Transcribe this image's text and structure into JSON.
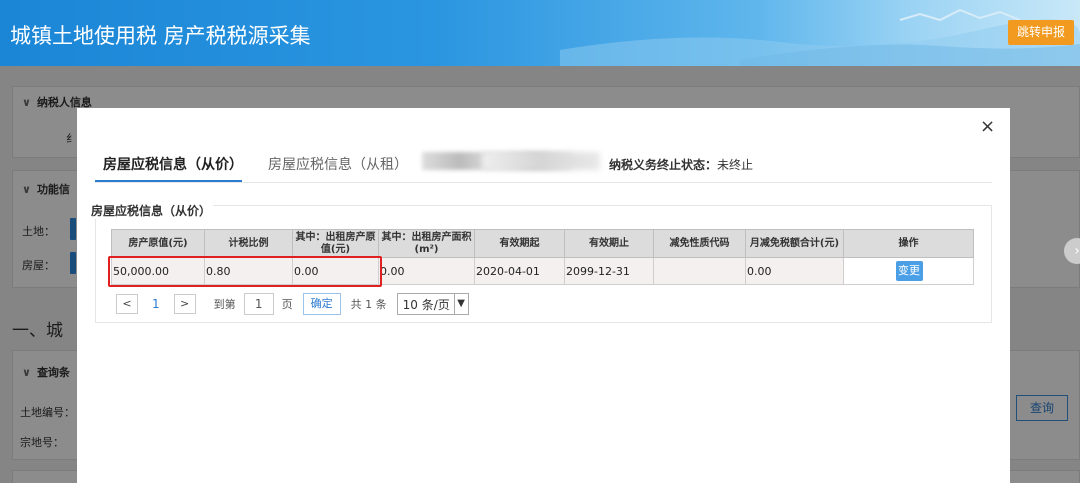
{
  "header": {
    "title": "城镇土地使用税 房产税税源采集",
    "jump_label": "跳转申报"
  },
  "background": {
    "section_taxpayer": "纳税人信息",
    "taxpayer_stub": "纟",
    "section_function": "功能信",
    "land_label": "土地：",
    "house_label": "房屋：",
    "heading": "一、城",
    "section_query": "查询条",
    "land_no_label": "土地编号：",
    "parcel_no_label": "宗地号：",
    "query_label": "查询"
  },
  "modal": {
    "close_glyph": "×",
    "tabs": [
      {
        "label": "房屋应税信息（从价）",
        "active": true
      },
      {
        "label": "房屋应税信息（从租）",
        "active": false
      }
    ],
    "status_label": "纳税义务终止状态：",
    "status_value": "未终止",
    "section_title": "房屋应税信息（从价）",
    "table": {
      "headers": [
        "房产原值(元)",
        "计税比例",
        "其中：出租房产原值(元)",
        "其中：出租房产面积(m²)",
        "有效期起",
        "有效期止",
        "减免性质代码",
        "月减免税额合计(元)",
        "操作"
      ],
      "rows": [
        [
          "50,000.00",
          "0.80",
          "0.00",
          "0.00",
          "2020-04-01",
          "2099-12-31",
          "",
          "0.00",
          "变更"
        ]
      ]
    },
    "pager": {
      "prev": "<",
      "current_page": "1",
      "next": ">",
      "goto_label": "到第",
      "goto_value": "1",
      "page_unit": "页",
      "confirm": "确定",
      "total": "共 1 条",
      "page_size": "10 条/页"
    }
  },
  "colors": {
    "accent": "#2b7bd0",
    "highlight": "#e02020",
    "jump": "#f29a1f"
  }
}
